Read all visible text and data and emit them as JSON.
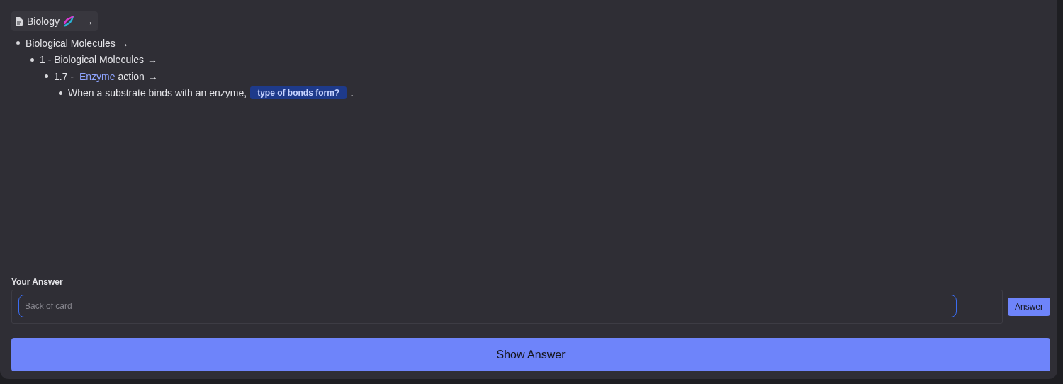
{
  "breadcrumb": {
    "title": "Biology",
    "arrow": "→"
  },
  "outline": [
    {
      "text": "Biological Molecules",
      "arrow": "→",
      "children": [
        {
          "text": "1 - Biological Molecules",
          "arrow": "→",
          "children": [
            {
              "text": "1.7 - ",
              "link": "Enzyme",
              "suffix": "action",
              "arrow": "→",
              "children": [
                {
                  "text": "When a substrate binds with an enzyme,",
                  "cloze": "type of bonds form?",
                  "tail": "."
                }
              ]
            }
          ]
        }
      ]
    }
  ],
  "answer": {
    "label": "Your Answer",
    "placeholder": "Back of card",
    "button": "Answer"
  },
  "show_answer": "Show Answer"
}
